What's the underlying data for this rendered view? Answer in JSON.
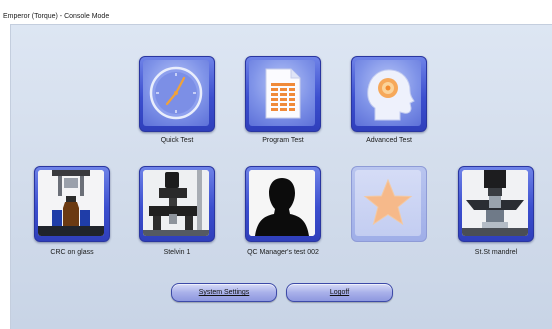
{
  "window": {
    "title": "Emperor (Torque) - Console Mode"
  },
  "tiles_top": [
    {
      "label": "Quick Test",
      "icon": "clock-icon"
    },
    {
      "label": "Program Test",
      "icon": "spreadsheet-document-icon"
    },
    {
      "label": "Advanced Test",
      "icon": "head-profile-icon"
    }
  ],
  "tiles_bottom": [
    {
      "label": "CRC on glass",
      "icon": "bottle-fixture-photo"
    },
    {
      "label": "Stelvin 1",
      "icon": "torque-tester-photo"
    },
    {
      "label": "QC Manager's test 002",
      "icon": "person-silhouette-icon"
    },
    {
      "label": "",
      "icon": "star-icon"
    },
    {
      "label": "St.St mandrel",
      "icon": "mandrel-fixture-photo"
    }
  ],
  "buttons": {
    "system_settings": "System Settings",
    "logoff": "Logoff"
  },
  "colors": {
    "tile_frame": "#3c4fcf",
    "tile_face": "#7f93e8",
    "background": "#d2dceb",
    "star": "#f6b98a"
  }
}
